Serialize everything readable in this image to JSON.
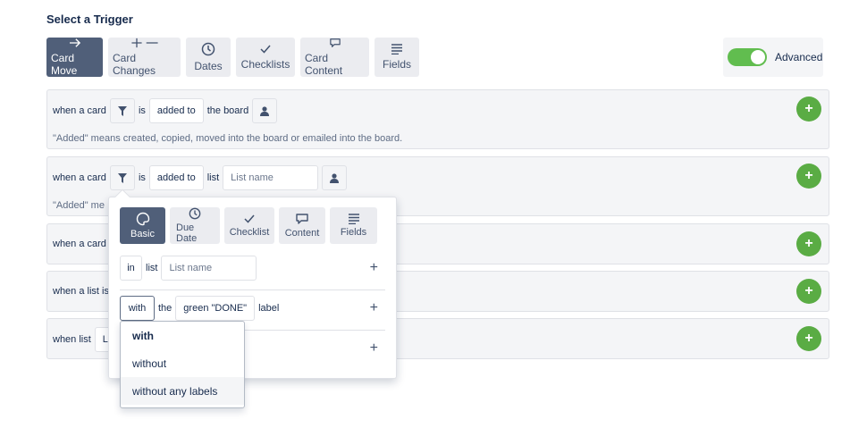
{
  "heading": "Select a Trigger",
  "tabs": [
    {
      "label": "Card Move",
      "icon": "arrow-right-icon",
      "active": true
    },
    {
      "label": "Card Changes",
      "icon": "plus-minus-icon"
    },
    {
      "label": "Dates",
      "icon": "clock-icon"
    },
    {
      "label": "Checklists",
      "icon": "checkmark-icon"
    },
    {
      "label": "Card Content",
      "icon": "speech-bubble-icon"
    },
    {
      "label": "Fields",
      "icon": "list-lines-icon"
    }
  ],
  "advanced": {
    "label": "Advanced",
    "on": true
  },
  "triggers": [
    {
      "prefix": "when a card",
      "is": "is",
      "action": "added to",
      "suffix": "the board",
      "note": "\"Added\" means created, copied, moved into the board or emailed into the board."
    },
    {
      "prefix": "when a card",
      "is": "is",
      "action": "added to",
      "suffix": "list",
      "list_placeholder": "List name",
      "note": "\"Added\" me"
    },
    {
      "prefix": "when a card"
    },
    {
      "prefix": "when a list is"
    },
    {
      "prefix": "when list",
      "partial": "L"
    }
  ],
  "popover": {
    "tabs": [
      {
        "label": "Basic",
        "icon": "palette-icon",
        "active": true
      },
      {
        "label": "Due Date",
        "icon": "clock-icon"
      },
      {
        "label": "Checklist",
        "icon": "checkmark-icon"
      },
      {
        "label": "Content",
        "icon": "speech-bubble-icon"
      },
      {
        "label": "Fields",
        "icon": "list-lines-icon"
      }
    ],
    "row1": {
      "select": "in",
      "label": "list",
      "placeholder": "List name"
    },
    "row2": {
      "select": "with",
      "the": "the",
      "label_value": "green \"DONE\"",
      "suffix": "label"
    }
  },
  "dropdown": {
    "options": [
      "with",
      "without",
      "without any labels"
    ],
    "selected": "with",
    "hovered": "without any labels"
  },
  "colors": {
    "active": "#505f79",
    "green": "#5aac44",
    "toggle": "#61bd4f"
  }
}
